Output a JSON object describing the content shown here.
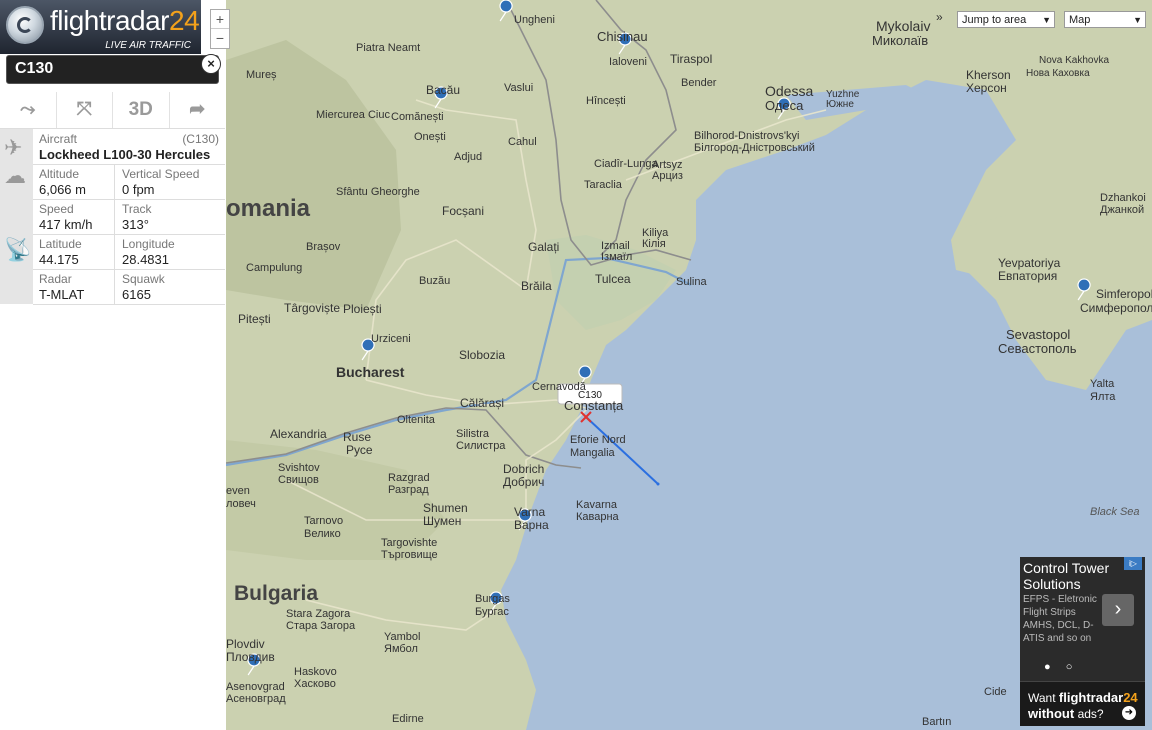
{
  "brand": {
    "name": "flightradar",
    "num": "24",
    "tagline": "LIVE AIR TRAFFIC",
    "ad_footer_prefix": "Want",
    "ad_footer_suffix": "without",
    "ad_footer_end": "ads?"
  },
  "zoom": {
    "in": "+",
    "out": "−"
  },
  "flight": {
    "callsign": "C130",
    "close": "×"
  },
  "tools": {
    "route": "⤳",
    "fit": "⤧",
    "three_d": "3D",
    "share": "➦"
  },
  "details": {
    "aircraft_label": "Aircraft",
    "aircraft_code": "(C130)",
    "aircraft_name": "Lockheed L100-30 Hercules",
    "altitude_label": "Altitude",
    "altitude": "6,066 m",
    "vspeed_label": "Vertical Speed",
    "vspeed": "0 fpm",
    "speed_label": "Speed",
    "speed": "417 km/h",
    "track_label": "Track",
    "track": "313°",
    "lat_label": "Latitude",
    "lat": "44.175",
    "lon_label": "Longitude",
    "lon": "28.4831",
    "radar_label": "Radar",
    "radar": "T-MLAT",
    "squawk_label": "Squawk",
    "squawk": "6165"
  },
  "controls": {
    "jump_label": "Jump to area",
    "map_type": "Map",
    "collapse": "»"
  },
  "map_labels": {
    "ungheni": "Ungheni",
    "chisinau": "Chisinau",
    "ialoveni": "Ialoveni",
    "tiraspol": "Tiraspol",
    "bender": "Bender",
    "mykolaiv": "Mykolaiv",
    "mykolaiv_uk": "Миколаїв",
    "kherson": "Kherson",
    "kherson_uk": "Херсон",
    "nkakhovka": "Nova Kakhovka",
    "nkakhovka_uk": "Нова Каховка",
    "odessa": "Odessa",
    "odessa_uk": "Одеса",
    "yuzhne": "Yuzhne",
    "yuzhne_uk": "Южне",
    "bilhorod": "Bilhorod-Dnistrovs'kyi",
    "bilhorod_uk": "Білгород-Дністровський",
    "piatra": "Piatra Neamt",
    "bacau": "Bacău",
    "vaslui": "Vaslui",
    "hincesti": "Hîncești",
    "comanesti": "Comănești",
    "onesti": "Onești",
    "adjud": "Adjud",
    "cahul": "Cahul",
    "cl_lunga": "Ciadîr-Lunga",
    "artsyz": "Artsyz",
    "artsyz_uk": "Арциз",
    "tarutyne": "Taraclia",
    "romania": "omania",
    "focsani": "Focșani",
    "sfgheorghe": "Sfântu Gheorghe",
    "brasov": "Brașov",
    "galati": "Galați",
    "izmail": "Izmail",
    "izmail_uk": "Ізмаїл",
    "kiliya": "Kiliya",
    "kiliya_uk": "Кілія",
    "braila": "Brăila",
    "tulcea": "Tulcea",
    "sulina": "Sulina",
    "buzau": "Buzău",
    "campulung": "Campulung",
    "dzhankoi": "Dzhankoi",
    "dzhankoi_uk": "Джанкой",
    "yevpatoria": "Yevpatoriya",
    "yevpatoria_uk": "Евпатория",
    "simferopol": "Simferopol",
    "simferopol_uk": "Симферополь",
    "sevastopol": "Sevastopol",
    "sevastopol_uk": "Севастополь",
    "yalta": "Yalta",
    "yalta_uk": "Ялта",
    "pitesti": "Pitești",
    "targoviste": "Târgoviște",
    "ploiesti": "Ploiești",
    "urziceni": "Urziceni",
    "slobozia": "Slobozia",
    "bucharest": "Bucharest",
    "calarasi": "Călărași",
    "cernavoda": "Cernavodă",
    "constanta": "Constanța",
    "oltenita": "Oltenita",
    "alexandria": "Alexandria",
    "ruse": "Ruse",
    "ruse_bg": "Русе",
    "silistra": "Silistra",
    "silistra_bg": "Силистра",
    "eforie": "Eforie Nord",
    "mangalia": "Mangalia",
    "svishtov": "Svishtov",
    "svishtov_bg": "Свищов",
    "dobrich": "Dobrich",
    "dobrich_bg": "Добрич",
    "razgrad": "Razgrad",
    "razgrad_bg": "Разград",
    "shumen": "Shumen",
    "shumen_bg": "Шумен",
    "kavarna": "Kavarna",
    "kavarna_bg": "Каварна",
    "varna": "Varna",
    "varna_bg": "Варна",
    "tarnovo": "Tarnovo",
    "tarnovo_bg": "Велико",
    "targovishte": "Targovishte",
    "targovishte_bg": "Търговище",
    "even": "even",
    "even_bg": "ловеч",
    "bulgaria": "Bulgaria",
    "stara": "Stara Zagora",
    "stara_bg": "Стара Загора",
    "burgas": "Burgas",
    "burgas_bg": "Бургас",
    "yambol": "Yambol",
    "yambol_bg": "Ямбол",
    "plovdiv": "Plovdiv",
    "plovdiv_bg": "Пловдив",
    "haskovo": "Haskovo",
    "haskovo_bg": "Хасково",
    "asenovgrad": "Asenovgrad",
    "asenovgrad_bg": "Асеновград",
    "edirne": "Edirne",
    "bartin": "Bartın",
    "cide": "Cide",
    "blacksea": "Black Sea",
    "alexandria_bg": "",
    "sliven": "",
    "mures": "Mureș",
    "miercurea": "Miercurea Ciuc",
    "sfg": "Sfântu Gheorghe"
  },
  "aircraft_tag": "C130",
  "ad": {
    "title": "Control Tower Solutions",
    "desc": "EFPS - Eletronic Flight Strips AMHS, DCL, D-ATIS and so on",
    "dots": "● ○",
    "badge": "i▷"
  }
}
